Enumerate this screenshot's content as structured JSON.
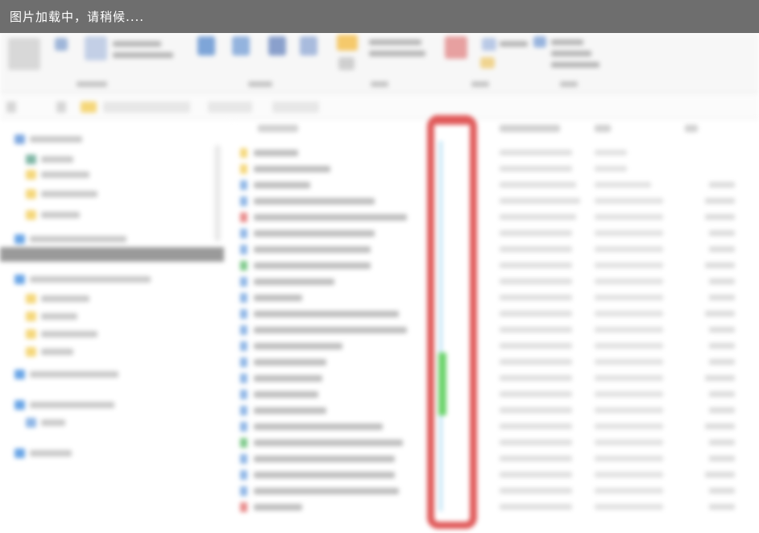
{
  "banner": {
    "loading_text": "图片加载中，请稍候...."
  },
  "colors": {
    "banner_bg": "#6e6e6e",
    "highlight": "#e05a5a",
    "status_sync": "#bfe3f5",
    "status_ok": "#6cd36c",
    "folder": "#f5d77a"
  },
  "icons": [
    "folder-icon",
    "onedrive-icon",
    "this-pc-icon",
    "network-icon",
    "back-icon",
    "forward-icon",
    "up-icon"
  ]
}
